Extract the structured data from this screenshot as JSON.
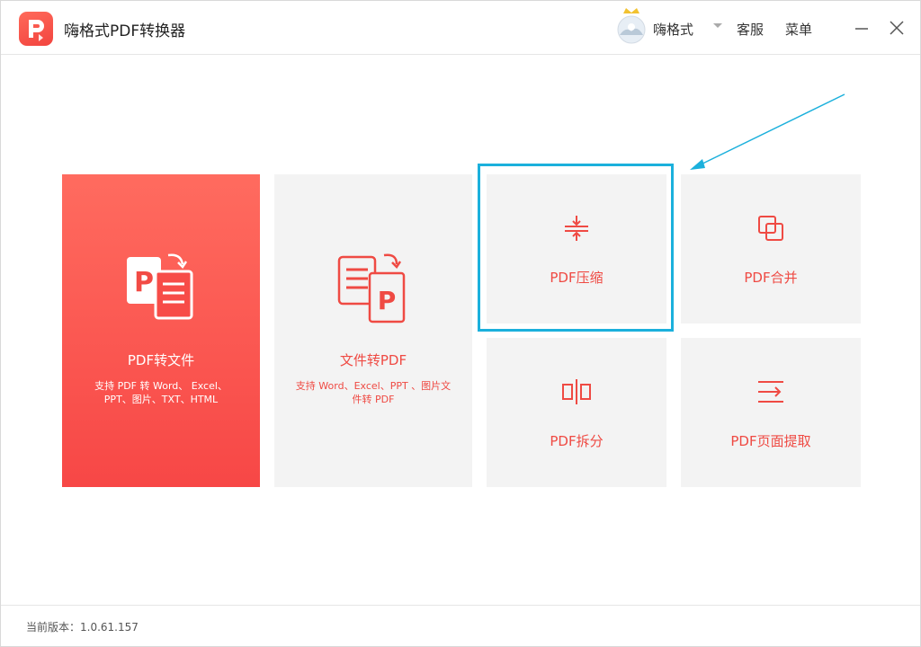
{
  "titlebar": {
    "app_title": "嗨格式PDF转换器",
    "username": "嗨格式",
    "service_label": "客服",
    "menu_label": "菜单"
  },
  "tiles": {
    "pdf_to_file": {
      "title": "PDF转文件",
      "desc_line1": "支持 PDF 转 Word、 Excel、",
      "desc_line2": "PPT、图片、TXT、HTML"
    },
    "file_to_pdf": {
      "title": "文件转PDF",
      "desc_line1": "支持 Word、Excel、PPT 、图片文",
      "desc_line2": "件转 PDF"
    },
    "compress": {
      "label": "PDF压缩"
    },
    "merge": {
      "label": "PDF合并"
    },
    "split": {
      "label": "PDF拆分"
    },
    "extract": {
      "label": "PDF页面提取"
    }
  },
  "footer": {
    "version": "当前版本：1.0.61.157"
  },
  "colors": {
    "accent_red": "#ef4a43",
    "highlight_blue": "#1bb0dc",
    "tile_bg": "#f3f3f3"
  }
}
